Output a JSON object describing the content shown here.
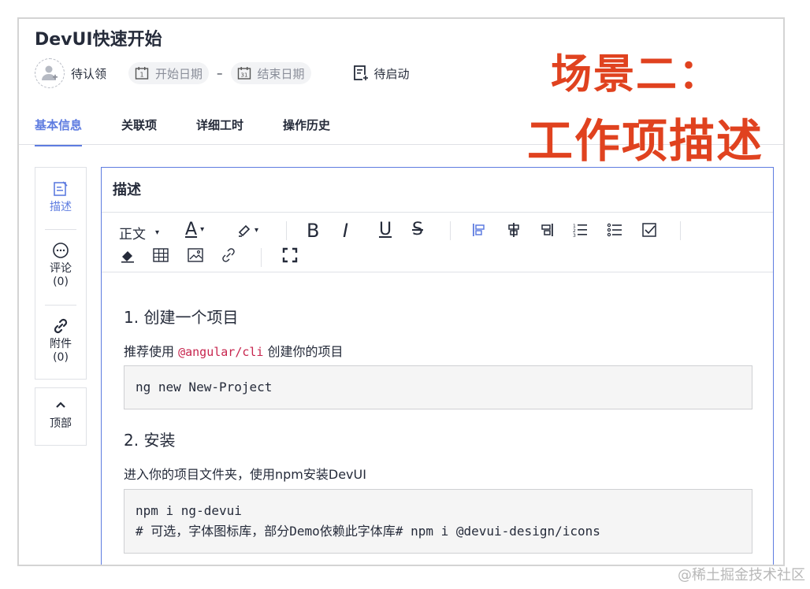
{
  "header": {
    "title": "DevUI快速开始",
    "assignee": "待认领",
    "start_date_placeholder": "开始日期",
    "date_separator": "–",
    "end_date_placeholder": "结束日期",
    "status": "待启动"
  },
  "overlay": {
    "line1": "场景二：",
    "line2": "工作项描述"
  },
  "tabs": [
    {
      "label": "基本信息",
      "active": true
    },
    {
      "label": "关联项"
    },
    {
      "label": "详细工时"
    },
    {
      "label": "操作历史"
    }
  ],
  "side_nav": {
    "description": "描述",
    "comments_label": "评论",
    "comments_count": "(0)",
    "attachments_label": "附件",
    "attachments_count": "(0)",
    "top": "顶部"
  },
  "editor": {
    "panel_title": "描述",
    "toolbar": {
      "format_label": "正文",
      "font_color_label": "A",
      "bold": "B",
      "italic": "I",
      "underline": "U",
      "strike": "S"
    }
  },
  "document": {
    "h1": "1. 创建一个项目",
    "p1_prefix": "推荐使用 ",
    "p1_code": "@angular/cli",
    "p1_suffix": " 创建你的项目",
    "code1": "ng new New-Project",
    "h2": "2. 安装",
    "p2": "进入你的项目文件夹，使用npm安装DevUI",
    "code2_line1": "npm i ng-devui",
    "code2_line2": "# 可选，字体图标库，部分Demo依赖此字体库# npm i @devui-design/icons"
  },
  "watermark": "@稀土掘金技术社区",
  "colors": {
    "accent": "#5e7ce0",
    "overlay": "#e0421f",
    "inline_code": "#c7254e"
  }
}
